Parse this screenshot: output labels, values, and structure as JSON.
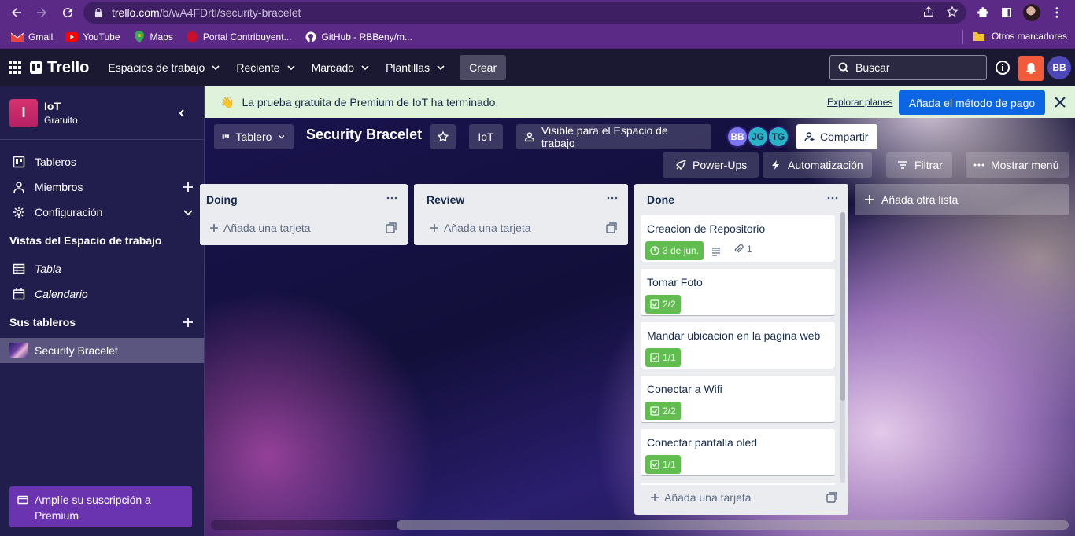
{
  "browser": {
    "url_host": "trello.com",
    "url_path": "/b/wA4FDrtl/security-bracelet",
    "bookmarks": [
      {
        "label": "Gmail",
        "icon": "gmail-icon"
      },
      {
        "label": "YouTube",
        "icon": "youtube-icon"
      },
      {
        "label": "Maps",
        "icon": "maps-icon"
      },
      {
        "label": "Portal Contribuyent...",
        "icon": "portal-icon"
      },
      {
        "label": "GitHub - RBBeny/m...",
        "icon": "github-icon"
      }
    ],
    "other_bookmarks": "Otros marcadores"
  },
  "header": {
    "logo": "Trello",
    "menus": [
      "Espacios de trabajo",
      "Reciente",
      "Marcado",
      "Plantillas"
    ],
    "create": "Crear",
    "search_placeholder": "Buscar",
    "avatar_initials": "BB"
  },
  "sidebar": {
    "workspace_initial": "I",
    "workspace_name": "IoT",
    "workspace_plan": "Gratuito",
    "items": [
      "Tableros",
      "Miembros",
      "Configuración"
    ],
    "views_heading": "Vistas del Espacio de trabajo",
    "views": [
      "Tabla",
      "Calendario"
    ],
    "boards_heading": "Sus tableros",
    "boards": [
      "Security Bracelet"
    ],
    "upgrade_text": "Amplíe su suscripción a Premium"
  },
  "banner": {
    "text": "La prueba gratuita de Premium de IoT ha terminado.",
    "explore": "Explorar planes",
    "cta": "Añada el método de pago"
  },
  "board": {
    "view": "Tablero",
    "title": "Security Bracelet",
    "workspace": "IoT",
    "visibility": "Visible para el Espacio de trabajo",
    "members": [
      "BB",
      "JG",
      "TG"
    ],
    "share": "Compartir",
    "powerups": "Power-Ups",
    "automation": "Automatización",
    "filter": "Filtrar",
    "menu": "Mostrar menú",
    "add_list": "Añada otra lista"
  },
  "lists": [
    {
      "title": "Doing",
      "add_card": "Añada una tarjeta"
    },
    {
      "title": "Review",
      "add_card": "Añada una tarjeta"
    },
    {
      "title": "Done",
      "add_card": "Añada una tarjeta",
      "cards": [
        {
          "title": "Creacion de Repositorio",
          "due": "3 de jun.",
          "attachments": "1"
        },
        {
          "title": "Tomar Foto",
          "checklist": "2/2"
        },
        {
          "title": "Mandar ubicacion en la pagina web",
          "checklist": "1/1"
        },
        {
          "title": "Conectar a Wifi",
          "checklist": "2/2"
        },
        {
          "title": "Conectar pantalla oled",
          "checklist": "1/1"
        }
      ]
    }
  ],
  "colors": {
    "browser_purple": "#5b2a86",
    "header_dark": "#1a1931",
    "sidebar": "#211d4d",
    "banner_green": "#dff3dc",
    "cta_blue": "#0c66e4",
    "label_green": "#61bd4f",
    "bell_red": "#f15a3a"
  }
}
